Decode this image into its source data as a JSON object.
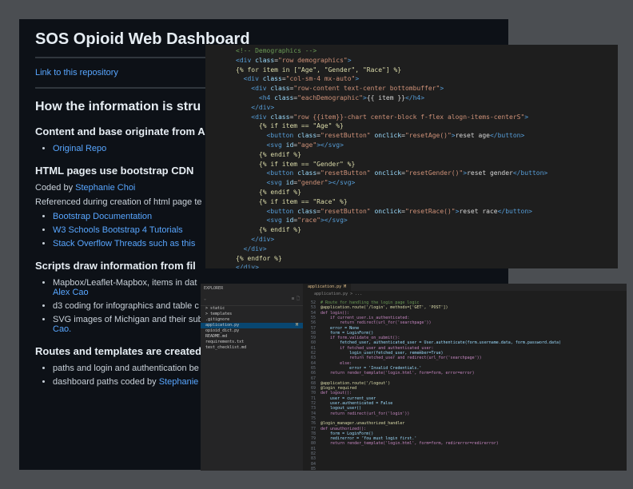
{
  "readme": {
    "title": "SOS Opioid Web Dashboard",
    "repo_link": "Link to this repository",
    "h_info": "How the information is stru",
    "h_content": "Content and base originate from A",
    "original_repo": "Original Repo",
    "h_html": "HTML pages use bootstrap CDN",
    "coded_by_prefix": "Coded by ",
    "coded_by_name": "Stephanie Choi",
    "referenced": "Referenced during creation of html page te",
    "ref_links": [
      "Bootstrap Documentation",
      "W3 Schools Bootstrap 4 Tutorials",
      "Stack Overflow Threads such as this"
    ],
    "h_scripts": "Scripts draw information from fil",
    "script_items": [
      {
        "text": "Mapbox/Leaflet-Mapbox, items in dat",
        "link": "Alex Cao"
      },
      {
        "text": "d3 coding for infographics and table c",
        "link": ""
      },
      {
        "text": "SVG images of Michigan and their sub",
        "link": "Cao."
      }
    ],
    "h_routes": "Routes and templates are created",
    "route_items": [
      {
        "text": "paths and login and authentication be",
        "link": ""
      },
      {
        "text": "dashboard paths coded by ",
        "link": "Stephanie"
      }
    ]
  },
  "code_top": {
    "lines": [
      [
        [
          "c-com",
          "<!-- Demographics -->"
        ]
      ],
      [
        [
          "c-tag",
          "<div "
        ],
        [
          "c-attr",
          "class"
        ],
        [
          "c-txt",
          "="
        ],
        [
          "c-str",
          "\"row demographics\""
        ],
        [
          "c-tag",
          ">"
        ]
      ],
      [
        [
          "c-jinja",
          "{% for item in [\"Age\", \"Gender\", \"Race\"] %}"
        ]
      ],
      [
        [
          "c-txt",
          "  "
        ],
        [
          "c-tag",
          "<div "
        ],
        [
          "c-attr",
          "class"
        ],
        [
          "c-txt",
          "="
        ],
        [
          "c-str",
          "\"col-sm-4 mx-auto\""
        ],
        [
          "c-tag",
          ">"
        ]
      ],
      [
        [
          "c-txt",
          "    "
        ],
        [
          "c-tag",
          "<div "
        ],
        [
          "c-attr",
          "class"
        ],
        [
          "c-txt",
          "="
        ],
        [
          "c-str",
          "\"row-content text-center bottombuffer\""
        ],
        [
          "c-tag",
          ">"
        ]
      ],
      [
        [
          "c-txt",
          "      "
        ],
        [
          "c-tag",
          "<h4 "
        ],
        [
          "c-attr",
          "class"
        ],
        [
          "c-txt",
          "="
        ],
        [
          "c-str",
          "\"eachDemographic\""
        ],
        [
          "c-tag",
          ">"
        ],
        [
          "c-txt",
          "{{ item }}"
        ],
        [
          "c-tag",
          "</h4>"
        ]
      ],
      [
        [
          "c-txt",
          "    "
        ],
        [
          "c-tag",
          "</div>"
        ]
      ],
      [
        [
          "c-txt",
          "    "
        ],
        [
          "c-tag",
          "<div "
        ],
        [
          "c-attr",
          "class"
        ],
        [
          "c-txt",
          "="
        ],
        [
          "c-str",
          "\"row {{item}}-chart center-block f-flex alogn-items-centerS\""
        ],
        [
          "c-tag",
          ">"
        ]
      ],
      [
        [
          "c-txt",
          "      "
        ],
        [
          "c-jinja",
          "{% if item == \"Age\" %}"
        ]
      ],
      [
        [
          "c-txt",
          "        "
        ],
        [
          "c-tag",
          "<button "
        ],
        [
          "c-attr",
          "class"
        ],
        [
          "c-txt",
          "="
        ],
        [
          "c-str",
          "\"resetButton\""
        ],
        [
          "c-txt",
          " "
        ],
        [
          "c-attr",
          "onclick"
        ],
        [
          "c-txt",
          "="
        ],
        [
          "c-str",
          "\"resetAge()\""
        ],
        [
          "c-tag",
          ">"
        ],
        [
          "c-txt",
          "reset age"
        ],
        [
          "c-tag",
          "</button>"
        ]
      ],
      [
        [
          "c-txt",
          "        "
        ],
        [
          "c-tag",
          "<svg "
        ],
        [
          "c-attr",
          "id"
        ],
        [
          "c-txt",
          "="
        ],
        [
          "c-str",
          "\"age\""
        ],
        [
          "c-tag",
          "></svg>"
        ]
      ],
      [
        [
          "c-txt",
          "      "
        ],
        [
          "c-jinja",
          "{% endif %}"
        ]
      ],
      [
        [
          "c-txt",
          "      "
        ],
        [
          "c-jinja",
          "{% if item == \"Gender\" %}"
        ]
      ],
      [
        [
          "c-txt",
          "        "
        ],
        [
          "c-tag",
          "<button "
        ],
        [
          "c-attr",
          "class"
        ],
        [
          "c-txt",
          "="
        ],
        [
          "c-str",
          "\"resetButton\""
        ],
        [
          "c-txt",
          " "
        ],
        [
          "c-attr",
          "onclick"
        ],
        [
          "c-txt",
          "="
        ],
        [
          "c-str",
          "\"resetGender()\""
        ],
        [
          "c-tag",
          ">"
        ],
        [
          "c-txt",
          "reset gender"
        ],
        [
          "c-tag",
          "</button>"
        ]
      ],
      [
        [
          "c-txt",
          "        "
        ],
        [
          "c-tag",
          "<svg "
        ],
        [
          "c-attr",
          "id"
        ],
        [
          "c-txt",
          "="
        ],
        [
          "c-str",
          "\"gender\""
        ],
        [
          "c-tag",
          "></svg>"
        ]
      ],
      [
        [
          "c-txt",
          "      "
        ],
        [
          "c-jinja",
          "{% endif %}"
        ]
      ],
      [
        [
          "c-txt",
          "      "
        ],
        [
          "c-jinja",
          "{% if item == \"Race\" %}"
        ]
      ],
      [
        [
          "c-txt",
          "        "
        ],
        [
          "c-tag",
          "<button "
        ],
        [
          "c-attr",
          "class"
        ],
        [
          "c-txt",
          "="
        ],
        [
          "c-str",
          "\"resetButton\""
        ],
        [
          "c-txt",
          " "
        ],
        [
          "c-attr",
          "onclick"
        ],
        [
          "c-txt",
          "="
        ],
        [
          "c-str",
          "\"resetRace()\""
        ],
        [
          "c-tag",
          ">"
        ],
        [
          "c-txt",
          "reset race"
        ],
        [
          "c-tag",
          "</button>"
        ]
      ],
      [
        [
          "c-txt",
          "        "
        ],
        [
          "c-tag",
          "<svg "
        ],
        [
          "c-attr",
          "id"
        ],
        [
          "c-txt",
          "="
        ],
        [
          "c-str",
          "\"race\""
        ],
        [
          "c-tag",
          "></svg>"
        ]
      ],
      [
        [
          "c-txt",
          "      "
        ],
        [
          "c-jinja",
          "{% endif %}"
        ]
      ],
      [
        [
          "c-txt",
          "    "
        ],
        [
          "c-tag",
          "</div>"
        ]
      ],
      [
        [
          "c-txt",
          "  "
        ],
        [
          "c-tag",
          "</div>"
        ]
      ],
      [
        [
          "c-jinja",
          "{% endfor %}"
        ]
      ],
      [
        [
          "c-tag",
          "</div>"
        ]
      ]
    ]
  },
  "code_bottom": {
    "explorer_title": "EXPLORER",
    "files": [
      {
        "name": "> static",
        "selected": false,
        "badge": ""
      },
      {
        "name": "> templates",
        "selected": false,
        "badge": ""
      },
      {
        "name": "  .gitignore",
        "selected": false,
        "badge": ""
      },
      {
        "name": "  application.py",
        "selected": true,
        "badge": "M"
      },
      {
        "name": "  opioid_dict.py",
        "selected": false,
        "badge": ""
      },
      {
        "name": "  README.md",
        "selected": false,
        "badge": ""
      },
      {
        "name": "  requirements.txt",
        "selected": false,
        "badge": ""
      },
      {
        "name": "  test_checklist.md",
        "selected": false,
        "badge": ""
      }
    ],
    "tab_label": "application.py M",
    "breadcrumb": "application.py > ...",
    "line_numbers": [
      "52",
      "53",
      "54",
      "55",
      "56",
      "57",
      "58",
      "59",
      "60",
      "61",
      "62",
      "63",
      "64",
      "65",
      "66",
      "67",
      "68",
      "69",
      "70",
      "71",
      "72",
      "73",
      "74",
      "75",
      "76",
      "77",
      "78",
      "79",
      "80",
      "81",
      "82",
      "83",
      "84",
      "85"
    ],
    "lines": [
      "# Route for handling the login page logic",
      "@application.route('/login', methods=['GET', 'POST'])",
      "def login():",
      "    if current_user.is_authenticated:",
      "        return redirect(url_for('searchpage'))",
      "    error = None",
      "    form = LoginForm()",
      "    if form.validate_on_submit():",
      "        fetched_user, authenticated_user = User.authenticate(form.username.data, form.password.data)",
      "        if fetched_user and authenticated_user:",
      "            login_user(fetched_user, remember=True)",
      "            return fetched_user and redirect(url_for('searchpage'))",
      "        else:",
      "            error = 'Invalid Credentials.'",
      "    return render_template('login.html', form=form, error=error)",
      "",
      "@application.route('/logout')",
      "@login_required",
      "def logout():",
      "    user = current_user",
      "    user.authenticated = False",
      "    logout_user()",
      "    return redirect(url_for('login'))",
      "",
      "@login_manager.unauthorized_handler",
      "def unauthorized():",
      "    form = LoginForm()",
      "    redirerror = 'You must login first.'",
      "    return render_template('login.html', form=form, redirerror=redirerror)",
      "",
      "",
      "",
      "",
      ""
    ]
  }
}
